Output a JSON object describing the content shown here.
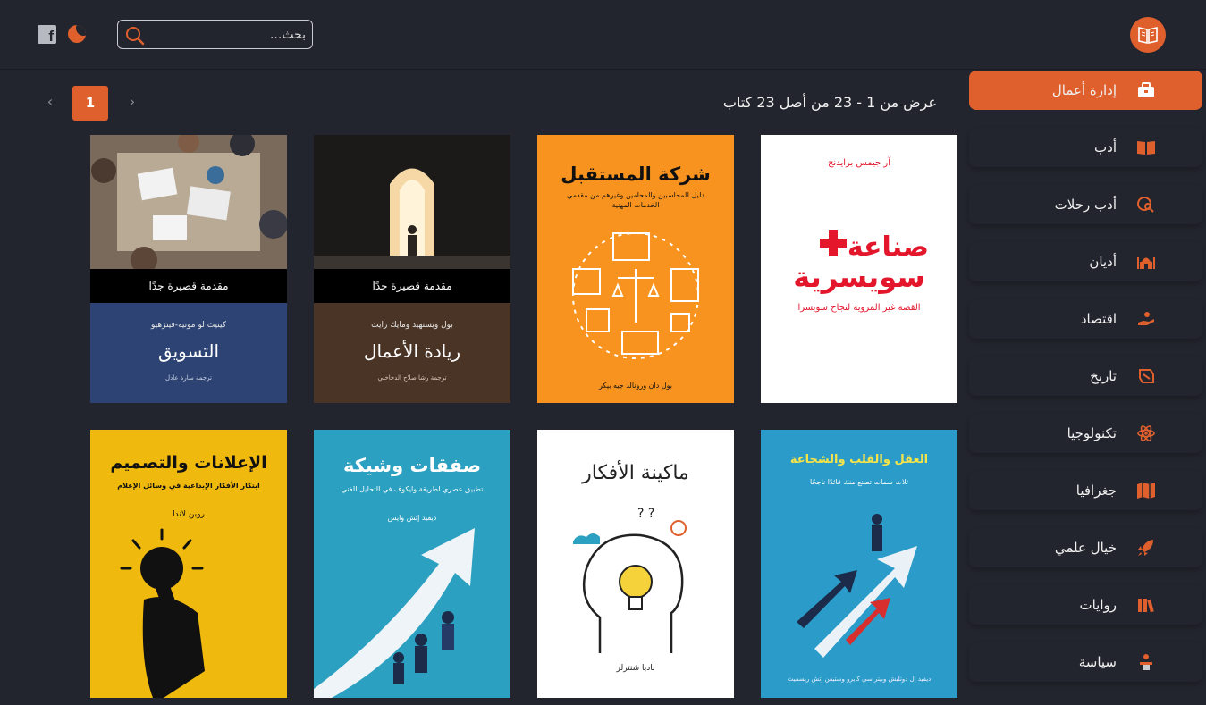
{
  "header": {
    "search_placeholder": "بحث...",
    "logo_icon": "open-book-icon",
    "facebook_icon": "facebook-icon",
    "theme_icon": "moon-icon"
  },
  "sidebar": {
    "items": [
      {
        "label": "إدارة أعمال",
        "icon": "briefcase-icon",
        "active": true
      },
      {
        "label": "أدب",
        "icon": "book-open-icon",
        "active": false
      },
      {
        "label": "أدب رحلات",
        "icon": "globe-search-icon",
        "active": false
      },
      {
        "label": "أديان",
        "icon": "mosque-icon",
        "active": false
      },
      {
        "label": "اقتصاد",
        "icon": "hand-coin-icon",
        "active": false
      },
      {
        "label": "تاريخ",
        "icon": "scroll-icon",
        "active": false
      },
      {
        "label": "تكنولوجيا",
        "icon": "atom-icon",
        "active": false
      },
      {
        "label": "جغرافيا",
        "icon": "map-icon",
        "active": false
      },
      {
        "label": "خيال علمي",
        "icon": "rocket-icon",
        "active": false
      },
      {
        "label": "روايات",
        "icon": "books-icon",
        "active": false
      },
      {
        "label": "سياسة",
        "icon": "podium-icon",
        "active": false
      }
    ]
  },
  "pagination": {
    "results_text": "عرض من 1 - 23 من أصل 23 كتاب",
    "current_page": "1",
    "prev_symbol": "›",
    "next_symbol": "‹"
  },
  "books": [
    {
      "series": "مقدمة قصيرة جدًا",
      "author": "كينيث لو مونيه-فيتزهيو",
      "title": "التسويق",
      "translator": "ترجمة سارة عادل"
    },
    {
      "series": "مقدمة قصيرة جدًا",
      "author": "بول ويستهيد ومايك رايت",
      "title": "ريادة الأعمال",
      "translator": "ترجمة رشا صلاح الدخاخني"
    },
    {
      "title": "شركة المستقبل",
      "subtitle": "دليل للمحاسبين والمحامين وغيرهم من مقدمي الخدمات المهنية",
      "author": "بول دان ورونالد جيه بيكر"
    },
    {
      "author": "آر جيمس برايدنج",
      "title_line1": "صناعة",
      "title_line2": "سويسرية",
      "subtitle": "القصة غير المروية لنجاح سويسرا"
    },
    {
      "title": "الإعلانات والتصميم",
      "subtitle": "ابتكار الأفكار الإبداعية في وسائل الإعلام",
      "author": "روبن لاندا"
    },
    {
      "title": "صفقات وشيكة",
      "subtitle": "تطبيق عصري لطريقة وايكوف في التحليل الفني",
      "author": "ديفيد إتش وايس"
    },
    {
      "title": "ماكينة الأفكار",
      "author": "ناديا شنتزلر"
    },
    {
      "title": "العقل والقلب والشجاعة",
      "subtitle": "ثلاث سمات تصنع منك قائدًا ناجحًا",
      "author": "ديفيد إل دوتليش وبيتر سي كايرو وستيفن إتش ريسميث"
    }
  ],
  "colors": {
    "accent": "#e0602d",
    "background": "#23252e"
  }
}
